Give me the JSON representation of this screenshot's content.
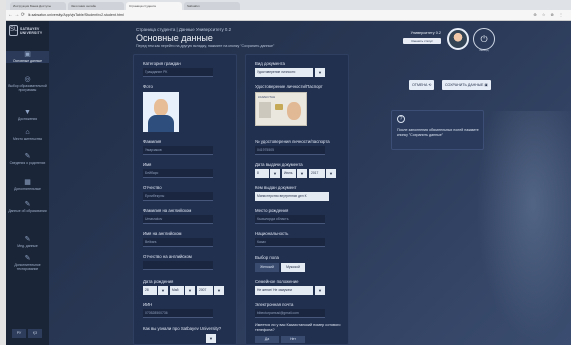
{
  "browser": {
    "tabs": [
      "Инструкция Банка Доступы",
      "Заголовки онлайн",
      "Страница студента",
      "Sabsafun"
    ],
    "url": "lk.sabsafun.university/App/vjsTable/Student/rc2.student.html",
    "nav": "← → ⟳",
    "ext": "⊕ ☆ ⊗ ⋮"
  },
  "sidebar": {
    "logo_mark": "SU",
    "logo_text": "SATBAYEV UNIVERSITY",
    "items": [
      {
        "icon": "▣",
        "label": "Основные данные"
      },
      {
        "icon": "◎",
        "label": "Выбор образовательной программы"
      },
      {
        "icon": "▼",
        "label": "Достижения"
      },
      {
        "icon": "⌂",
        "label": "Место жительства"
      },
      {
        "icon": "✎",
        "label": "Сведения о родителях"
      },
      {
        "icon": "▦",
        "label": "Дополнительные"
      },
      {
        "icon": "✎",
        "label": "Данные об образовании"
      },
      {
        "icon": "✎",
        "label": "Мед. данные"
      },
      {
        "icon": "✎",
        "label": "Дополнительное тестирование"
      }
    ],
    "lang_ru": "РУ",
    "lang_kz": "ҚЗ"
  },
  "header": {
    "crumb": "Страница студента | Данные Университету 0.2",
    "title": "Основные данные",
    "subtitle": "Перед тем как перейти на другую вкладку, нажмите на кнопку \"Сохранить данные\""
  },
  "user": {
    "name": "Университету 0.2",
    "profile": "Сменить статус",
    "logout_icon": "⏻",
    "logout": "Выход"
  },
  "form": {
    "left": {
      "category_label": "Категория граждан",
      "category_value": "Гражданин РК",
      "photo_label": "Фото",
      "surname_label": "Фамилия",
      "surname_value": "Умарзаков",
      "name_label": "Имя",
      "name_value": "Бейбарс",
      "patronymic_label": "Отчество",
      "patronymic_value": "Ерлибекулы",
      "surname_en_label": "Фамилия на английском",
      "surname_en_value": "Umarzakov",
      "name_en_label": "Имя на английском",
      "name_en_value": "Beibars",
      "patronymic_en_label": "Отчество на английском",
      "patronymic_en_value": "",
      "birthdate_label": "Дата рождения",
      "birth_day": "28",
      "birth_month": "Май",
      "birth_year": "2007",
      "iin_label": "ИИН",
      "iin_value": "070528500736",
      "source_label": "Как вы узнали про Satbayev University?"
    },
    "right": {
      "doc_type_label": "Вид документа",
      "doc_type_value": "Удостоверение личности",
      "id_label": "Удостоверение личности/Паспорт",
      "id_card_header": "КАЗАКСТАН",
      "id_number_label": "№ удостоверения личности/паспорта",
      "id_number_value": "041975505",
      "issue_date_label": "Дата выдачи документа",
      "issue_day": "8",
      "issue_month": "Июль",
      "issue_year": "2017",
      "issued_by_label": "Кем выдан документ",
      "issued_by_value": "Министерство внутренних дел К",
      "birthplace_label": "Место рождения",
      "birthplace_value": "Кызылорда область",
      "nationality_label": "Национальность",
      "nationality_value": "Казах",
      "gender_label": "Выбор пола",
      "gender_female": "Женский",
      "gender_male": "Мужской",
      "marital_label": "Семейное положение",
      "marital_value": "Не женат/ Не замужем",
      "email_label": "Электронная почта",
      "email_value": "bibecturpamusi@gmail.com",
      "kz_phone_label": "Имеется ли у вас Казахстанский номер сотового телефона?",
      "kz_phone_yes": "Да",
      "kz_phone_no": "Нет"
    }
  },
  "actions": {
    "back": "ОТМЕНА",
    "back_icon": "⟲",
    "save": "СОХРАНИТЬ ДАННЫЕ",
    "save_icon": "▣"
  },
  "info": {
    "icon": "?",
    "text": "После заполнения обязательных полей нажмите кнопку \"Сохранить данные\""
  }
}
